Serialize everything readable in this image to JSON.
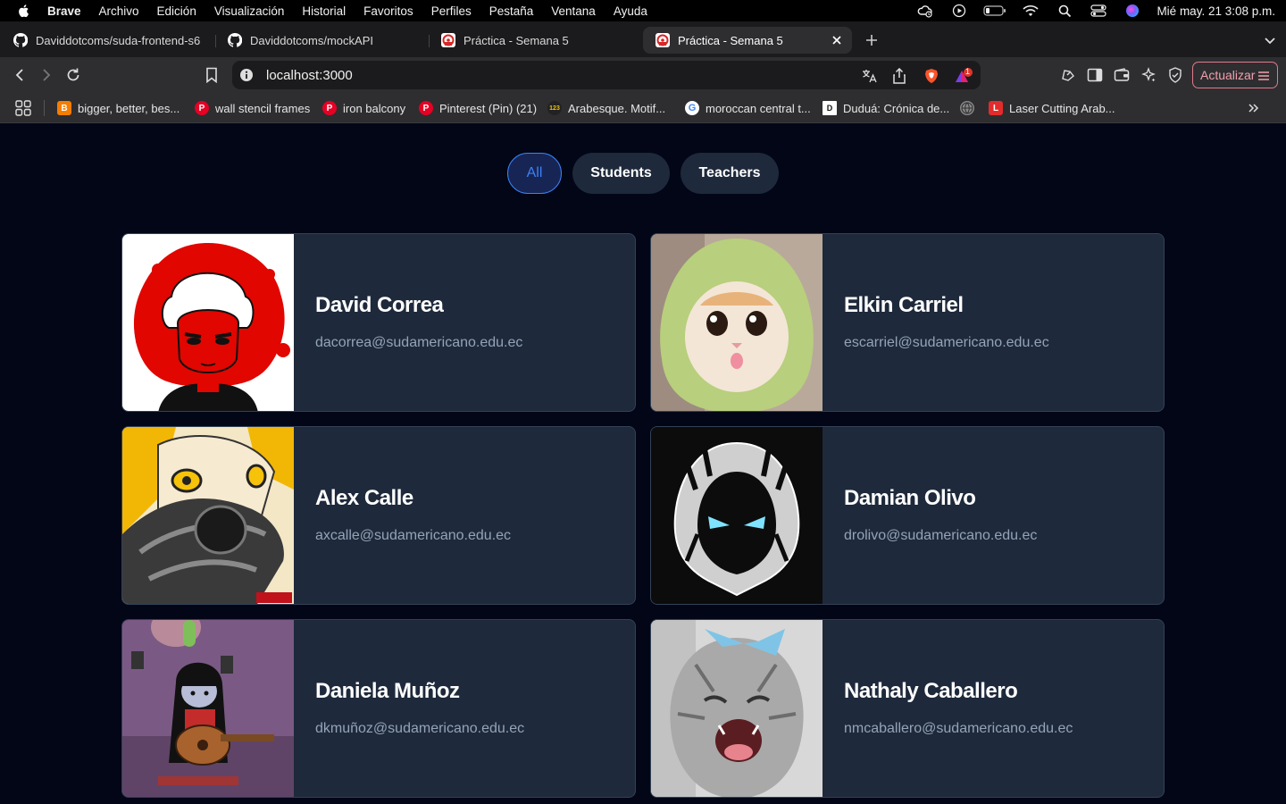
{
  "menubar": {
    "app_name": "Brave",
    "items": [
      "Archivo",
      "Edición",
      "Visualización",
      "Historial",
      "Favoritos",
      "Perfiles",
      "Pestaña",
      "Ventana",
      "Ayuda"
    ],
    "clock": "Mié may. 21  3:08 p.m."
  },
  "tabs": [
    {
      "title": "Daviddotcoms/suda-frontend-s6",
      "icon": "github-icon",
      "active": false
    },
    {
      "title": "Daviddotcoms/mockAPI",
      "icon": "github-icon",
      "active": false
    },
    {
      "title": "Práctica - Semana 5",
      "icon": "react-logo-icon",
      "active": false
    },
    {
      "title": "Práctica - Semana 5",
      "icon": "react-logo-icon",
      "active": true
    }
  ],
  "toolbar": {
    "url": "localhost:3000",
    "update_label": "Actualizar",
    "rewards_badge": "1"
  },
  "bookmarks": [
    {
      "label": "bigger, better, bes...",
      "icon": "blogger-icon",
      "color": "#f57d00",
      "glyph": "B"
    },
    {
      "label": "wall stencil frames",
      "icon": "pinterest-icon",
      "color": "#e60023",
      "glyph": "P"
    },
    {
      "label": "iron balcony",
      "icon": "pinterest-icon",
      "color": "#e60023",
      "glyph": "P"
    },
    {
      "label": "Pinterest (Pin) (21)",
      "icon": "pinterest-icon",
      "color": "#e60023",
      "glyph": "P"
    },
    {
      "label": "Arabesque. Motif...",
      "icon": "site-123-icon",
      "color": "#222222",
      "glyph": "123"
    },
    {
      "label": "moroccan central t...",
      "icon": "google-icon",
      "color": "#ffffff",
      "glyph": "G"
    },
    {
      "label": "Duduá: Crónica de...",
      "icon": "dudua-icon",
      "color": "#ffffff",
      "glyph": "D"
    },
    {
      "label": "",
      "icon": "globe-icon",
      "color": "#888888",
      "glyph": ""
    },
    {
      "label": "Laser Cutting Arab...",
      "icon": "laser-site-icon",
      "color": "#e32b2b",
      "glyph": "L"
    }
  ],
  "filters": [
    {
      "label": "All",
      "active": true
    },
    {
      "label": "Students",
      "active": false
    },
    {
      "label": "Teachers",
      "active": false
    }
  ],
  "people": [
    {
      "name": "David Correa",
      "email": "dacorrea@sudamericano.edu.ec",
      "avatar": "red-anime-character-avatar"
    },
    {
      "name": "Elkin Carriel",
      "email": "escarriel@sudamericano.edu.ec",
      "avatar": "cat-in-avocado-hat-avatar"
    },
    {
      "name": "Alex Calle",
      "email": "axcalle@sudamericano.edu.ec",
      "avatar": "anime-blonde-automail-avatar"
    },
    {
      "name": "Damian Olivo",
      "email": "drolivo@sudamericano.edu.ec",
      "avatar": "hooded-moon-knight-avatar"
    },
    {
      "name": "Daniela Muñoz",
      "email": "dkmuñoz@sudamericano.edu.ec",
      "avatar": "cartoon-guitar-player-avatar"
    },
    {
      "name": "Nathaly Caballero",
      "email": "nmcaballero@sudamericano.edu.ec",
      "avatar": "screaming-gray-cat-avatar"
    }
  ],
  "colors": {
    "page_bg": "#020617",
    "card_bg": "#1e293b",
    "card_border": "#334155",
    "email_text": "#94a3b8",
    "active_pill_border": "#3b82f6",
    "active_pill_bg": "#172554"
  }
}
